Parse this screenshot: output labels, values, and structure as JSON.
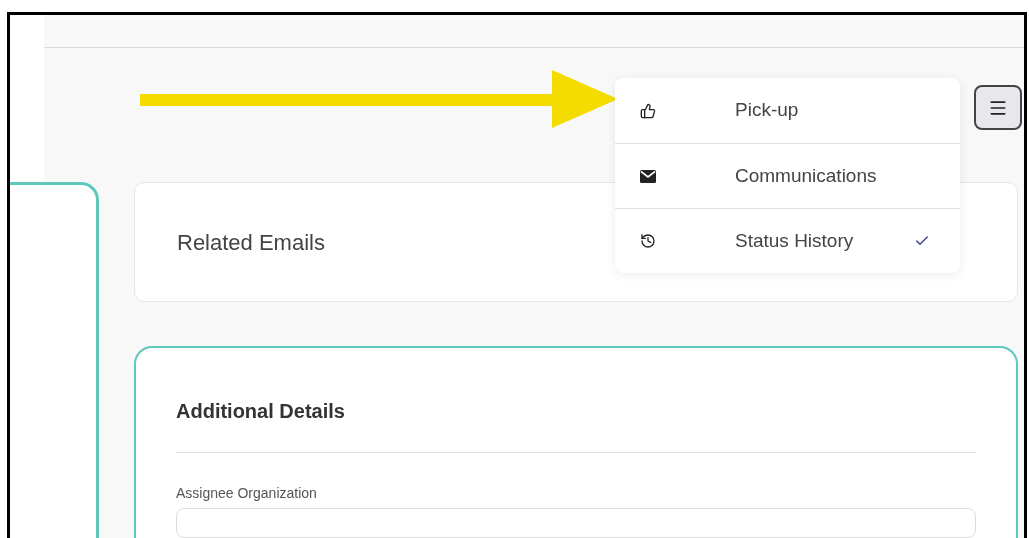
{
  "menu": {
    "items": [
      {
        "kind": "pickup",
        "label": "Pick-up",
        "checked": false
      },
      {
        "kind": "mail",
        "label": "Communications",
        "checked": false
      },
      {
        "kind": "history",
        "label": "Status History",
        "checked": true
      }
    ]
  },
  "related_emails": {
    "title": "Related Emails"
  },
  "additional_details": {
    "title": "Additional Details",
    "fields": [
      {
        "label": "Assignee Organization"
      }
    ]
  }
}
